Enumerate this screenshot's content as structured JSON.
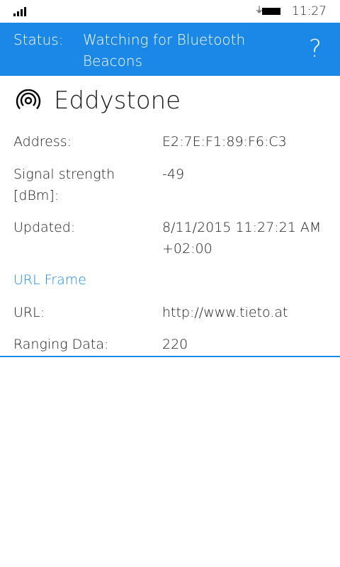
{
  "status_bar": {
    "time": "11:27",
    "signal_icon": "signal-icon",
    "battery_icon": "battery-charging-icon"
  },
  "app_bar": {
    "status_label": "Status:",
    "status_value": "Watching for Bluetooth Beacons",
    "help_icon": "?"
  },
  "beacon": {
    "icon": "beacon-icon",
    "title": "Eddystone",
    "fields": [
      {
        "key": "Address:",
        "value": "E2:7E:F1:89:F6:C3"
      },
      {
        "key": "Signal strength [dBm]:",
        "value": "-49"
      },
      {
        "key": "Updated:",
        "value": "8/11/2015 11:27:21 AM +02:00"
      }
    ],
    "section": "URL Frame",
    "url_fields": [
      {
        "key": "URL:",
        "value": "http://www.tieto.at"
      },
      {
        "key": "Ranging Data:",
        "value": "220"
      }
    ]
  },
  "colors": {
    "accent": "#1b88e8"
  }
}
